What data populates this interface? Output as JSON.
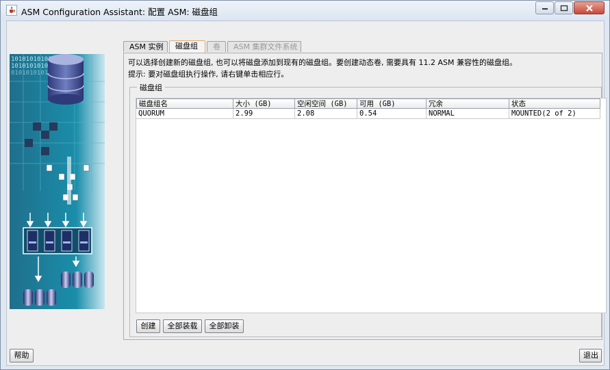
{
  "window": {
    "title": "ASM Configuration Assistant: 配置 ASM: 磁盘组",
    "icon": "java-cup-icon",
    "controls": [
      "minimize-icon",
      "maximize-icon",
      "close-icon"
    ]
  },
  "tabs": [
    {
      "label": "ASM 实例",
      "state": "normal"
    },
    {
      "label": "磁盘组",
      "state": "active"
    },
    {
      "label": "卷",
      "state": "disabled"
    },
    {
      "label": "ASM 集群文件系统",
      "state": "disabled"
    }
  ],
  "description": {
    "line1": "可以选择创建新的磁盘组, 也可以将磁盘添加到现有的磁盘组。要创建动态卷, 需要具有 11.2 ASM 兼容性的磁盘组。",
    "line2": "提示: 要对磁盘组执行操作, 请右键单击相应行。"
  },
  "group": {
    "title": "磁盘组",
    "columns": [
      "磁盘组名",
      "大小 (GB)",
      "空闲空间 (GB)",
      "可用 (GB)",
      "冗余",
      "状态"
    ],
    "rows": [
      [
        "QUORUM",
        "2.99",
        "2.08",
        "0.54",
        "NORMAL",
        "MOUNTED(2 of 2)"
      ]
    ],
    "buttons": {
      "create": "创建",
      "mount_all": "全部装载",
      "dismount_all": "全部卸装"
    }
  },
  "footer": {
    "help": "帮助",
    "exit": "退出"
  },
  "graphic": {
    "binary_text": "101010101010101010101"
  },
  "colors": {
    "accent_tab": "#e5a96a",
    "graphic_teal": "#1b7d96",
    "close_red": "#c7493a"
  }
}
